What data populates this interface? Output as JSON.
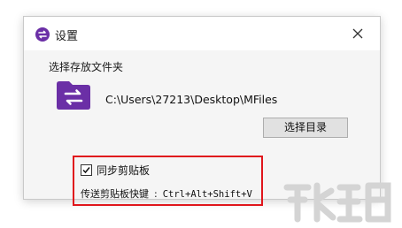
{
  "window": {
    "title": "设置",
    "app_icon": "app-logo-icon",
    "close_icon": "close-icon"
  },
  "storage": {
    "label": "选择存放文件夹",
    "folder_icon": "folder-sync-icon",
    "path": "C:\\Users\\27213\\Desktop\\MFiles",
    "select_button_label": "选择目录"
  },
  "clipboard": {
    "sync_label": "同步剪贴板",
    "sync_checked": true,
    "hotkey_label": "传送剪贴板快键",
    "hotkey_separator": ":",
    "hotkey_keys": "Ctrl+Alt+Shift+V"
  },
  "colors": {
    "accent": "#6b2fa6",
    "highlight_border": "#e0161c",
    "dialog_bg": "#f5f5f5",
    "titlebar_bg": "#ffffff",
    "button_bg": "#e1e1e1"
  }
}
